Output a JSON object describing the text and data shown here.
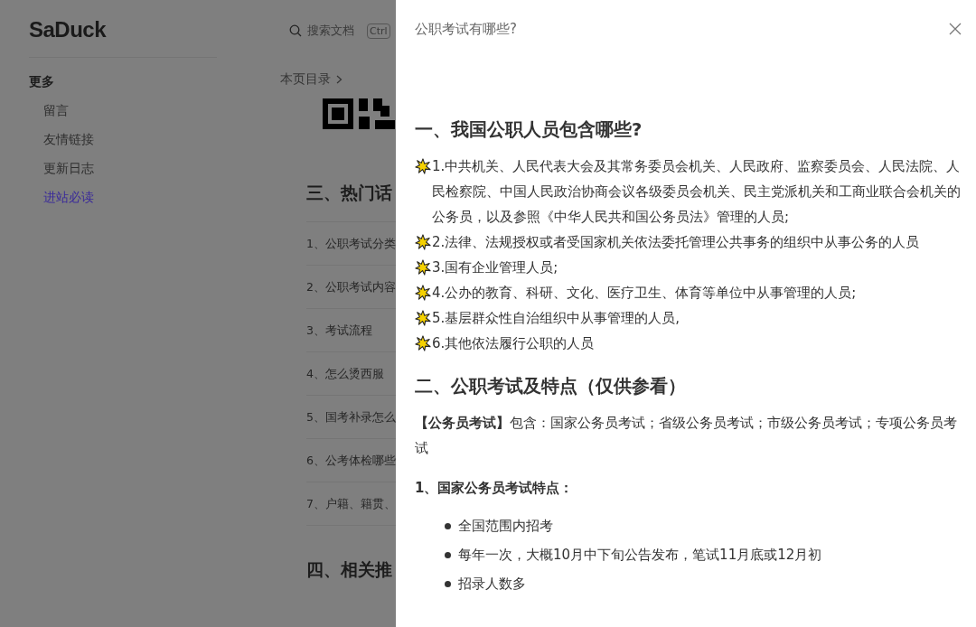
{
  "site": {
    "logo": "SaDuck",
    "search": {
      "placeholder": "搜索文档",
      "key": "Ctrl"
    }
  },
  "sidebar": {
    "group": "更多",
    "items": [
      {
        "label": "留言",
        "selected": false
      },
      {
        "label": "友情链接",
        "selected": false
      },
      {
        "label": "更新日志",
        "selected": false
      },
      {
        "label": "进站必读",
        "selected": true
      }
    ]
  },
  "main": {
    "toc": "本页目录",
    "heading_3": "三、热门话",
    "list": [
      "1、公职考试分类",
      "2、公职考试内容",
      "3、考试流程",
      "4、怎么烫西服",
      "5、国考补录怎么",
      "6、公考体检哪些",
      "7、户籍、籍贯、"
    ],
    "heading_4": "四、相关推"
  },
  "drawer": {
    "title": "公职考试有哪些?",
    "sections": [
      {
        "heading": "一、我国公职人员包含哪些?",
        "blocks": [
          {
            "kind": "star",
            "text": "1.中共机关、人民代表大会及其常务委员会机关、人民政府、监察委员会、人民法院、人民检察院、中国人民政治协商会议各级委员会机关、民主党派机关和工商业联合会机关的公务员，以及参照《中华人民共和国公务员法》管理的人员;"
          },
          {
            "kind": "star",
            "text": "2.法律、法规授权或者受国家机关依法委托管理公共事务的组织中从事公务的人员"
          },
          {
            "kind": "star",
            "text": "3.国有企业管理人员;"
          },
          {
            "kind": "star",
            "text": "4.公办的教育、科研、文化、医疗卫生、体育等单位中从事管理的人员;"
          },
          {
            "kind": "star",
            "text": "5.基层群众性自治组织中从事管理的人员,"
          },
          {
            "kind": "star",
            "text": "6.其他依法履行公职的人员"
          }
        ]
      },
      {
        "heading": "二、公职考试及特点（仅供参看）",
        "blocks": [
          {
            "kind": "paragraph",
            "text": "**【公务员考试】**包含：国家公务员考试；省级公务员考试；市级公务员考试；专项公务员考试"
          },
          {
            "kind": "subheading",
            "text": "1、国家公务员考试特点："
          },
          {
            "kind": "bullet",
            "text": "全国范围内招考"
          },
          {
            "kind": "bullet",
            "text": "每年一次，大概10月中下旬公告发布，笔试11月底或12月初"
          },
          {
            "kind": "bullet",
            "text": "招录人数多"
          }
        ]
      }
    ]
  }
}
